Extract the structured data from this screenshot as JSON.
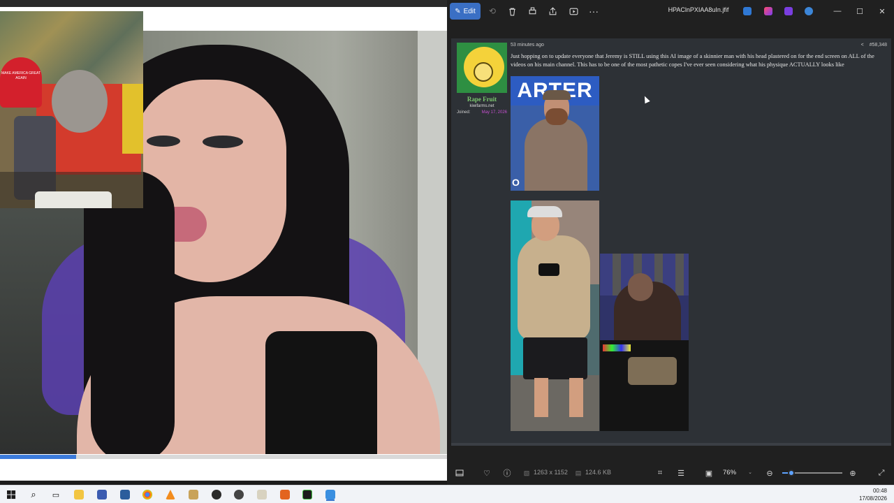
{
  "photos": {
    "toolbar": {
      "edit_label": "Edit",
      "title": "HPAClnPXIAA8uIn.jfif",
      "more_label": "···"
    },
    "post": {
      "username": "Rape Fruit",
      "site": "kiwifarms.net",
      "joined_label": "Joined:",
      "joined_date": "May 17, 2026",
      "time_ago": "53 minutes ago",
      "post_number": "#58,348",
      "text": "Just hopping on to update everyone that Jeremy is STILL using this AI image of a skinnier man with his head plastered on for the end screen on ALL of the videos on his main channel. This has to be one of the most pathetic copes I've ever seen considering what his physique ACTUALLY looks like",
      "image1_banner": "ARTER",
      "image1_badge": "O"
    },
    "statusbar": {
      "dimensions": "1263 x 1152",
      "filesize": "124.6 KB",
      "zoom": "76%",
      "zoom_fraction": 0.15
    }
  },
  "video": {
    "progress_fraction": 0.17,
    "hat_text": "MAKE AMERICA GREAT AGAIN"
  },
  "taskbar": {
    "time": "00:48",
    "date": "17/08/2026"
  }
}
